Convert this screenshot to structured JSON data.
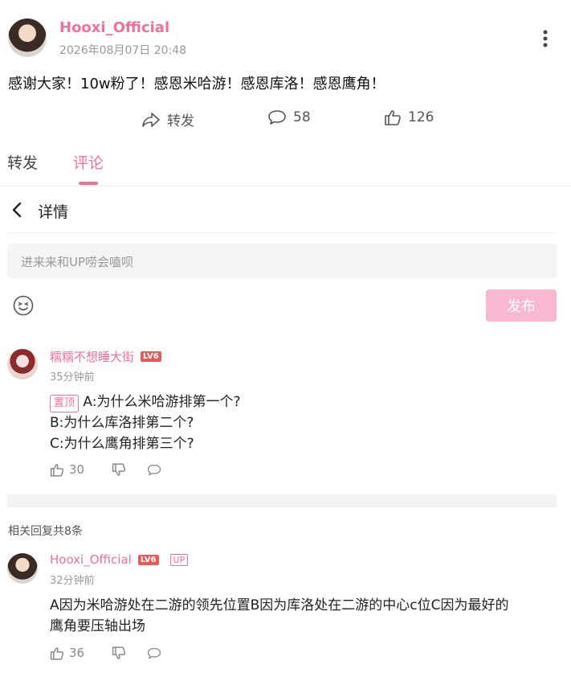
{
  "post": {
    "author": "Hooxi_Official",
    "time": "2026年08月07日 20:48",
    "text": "感谢大家！10w粉了！感恩米哈游！感恩库洛！感恩鹰角！",
    "actions": {
      "forward_label": "转发",
      "comment_count": "58",
      "like_count": "126"
    }
  },
  "tabs": {
    "forward": "转发",
    "comments": "评论"
  },
  "detail": {
    "title": "详情"
  },
  "composer": {
    "placeholder": "进来来和UP唠会嗑呗",
    "publish_label": "发布"
  },
  "comment": {
    "user": "糯糯不想睡大街",
    "level": "LV6",
    "time": "35分钟前",
    "pin_label": "置顶",
    "line1": "A:为什么米哈游排第一个?",
    "line2": "B:为什么库洛排第二个?",
    "line3": "C:为什么鹰角排第三个?",
    "likes": "30"
  },
  "replies_count_text": "相关回复共8条",
  "reply": {
    "user": "Hooxi_Official",
    "level": "LV6",
    "badge": "UP",
    "time": "32分钟前",
    "text_line1": "A因为米哈游处在二游的领先位置B因为库洛处在二游的中心c位C因为最好的",
    "text_line2": "鹰角要压轴出场",
    "likes": "36"
  },
  "colors": {
    "accent": "#ef6f9e",
    "publish_bg": "#f9b8d1"
  }
}
